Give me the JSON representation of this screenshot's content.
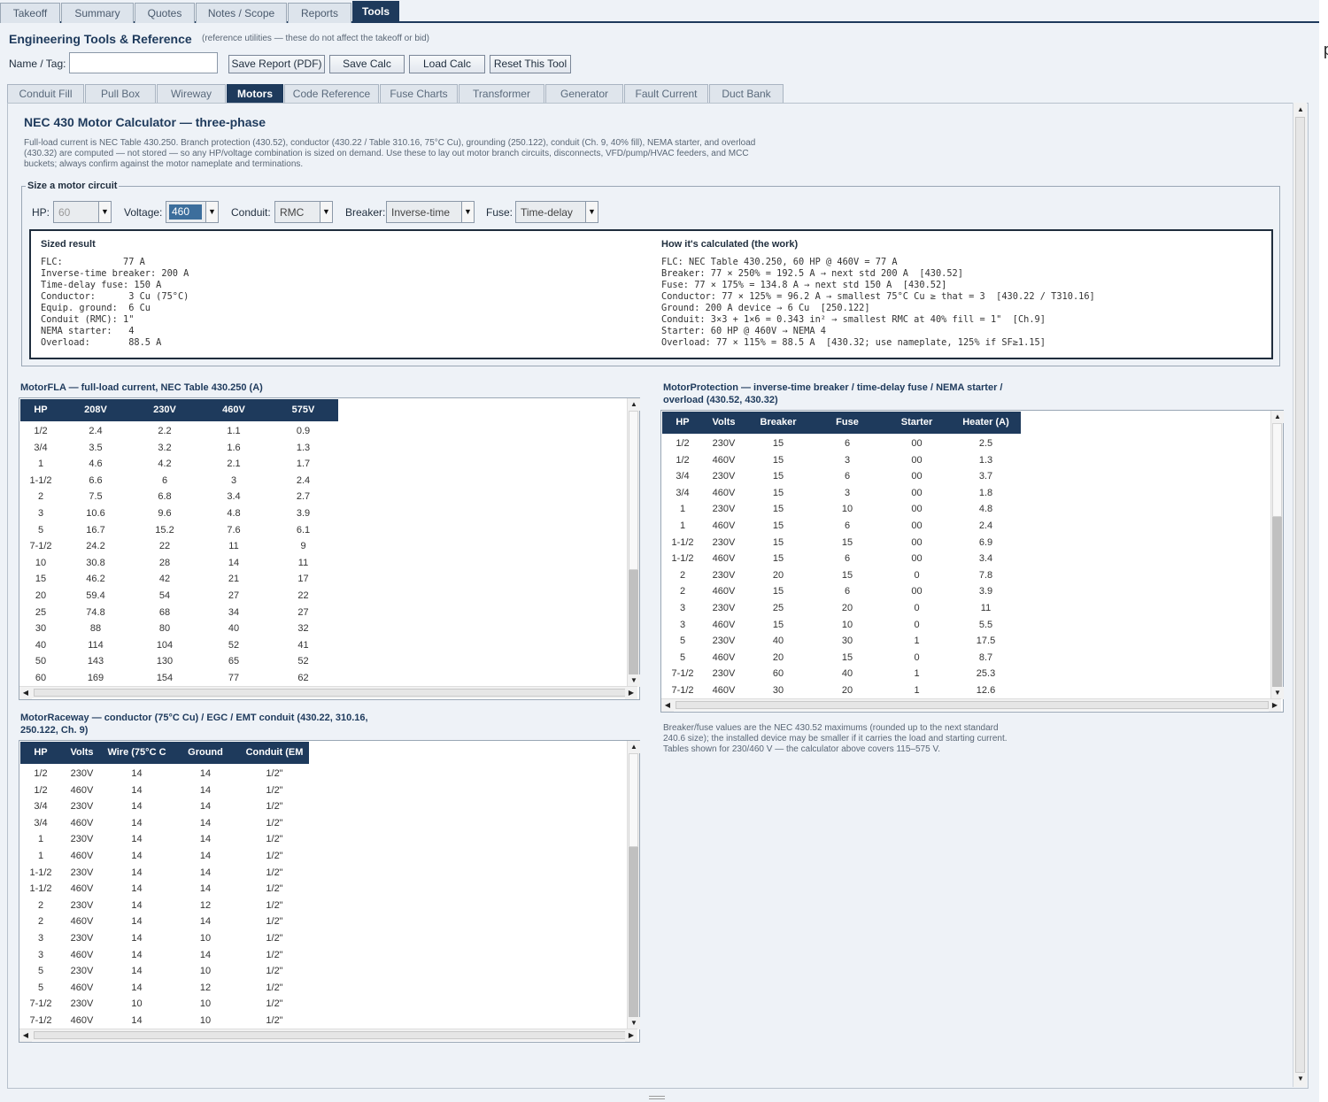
{
  "top_tabs": [
    {
      "label": "Takeoff"
    },
    {
      "label": "Summary"
    },
    {
      "label": "Quotes"
    },
    {
      "label": "Notes / Scope"
    },
    {
      "label": "Reports"
    },
    {
      "label": "Tools",
      "active": true
    }
  ],
  "header": {
    "title": "Engineering Tools & Reference",
    "subtitle": "(reference utilities — these do not affect the takeoff or bid)",
    "name_label": "Name / Tag:",
    "name_value": "",
    "buttons": {
      "save_report": "Save Report (PDF)",
      "save_calc": "Save Calc",
      "load_calc": "Load Calc",
      "reset": "Reset This Tool"
    }
  },
  "tool_tabs": [
    {
      "label": "Conduit Fill"
    },
    {
      "label": "Pull Box"
    },
    {
      "label": "Wireway"
    },
    {
      "label": "Motors",
      "active": true
    },
    {
      "label": "Code Reference"
    },
    {
      "label": "Fuse Charts"
    },
    {
      "label": "Transformer"
    },
    {
      "label": "Generator"
    },
    {
      "label": "Fault Current"
    },
    {
      "label": "Duct Bank"
    }
  ],
  "calculator": {
    "title": "NEC 430 Motor Calculator — three-phase",
    "description": "Full-load current is NEC Table 430.250. Branch protection (430.52), conductor (430.22 / Table 310.16, 75°C Cu), grounding (250.122), conduit (Ch. 9, 40% fill), NEMA starter, and overload (430.32) are computed — not stored — so any HP/voltage combination is sized on demand. Use these to lay out motor branch circuits, disconnects, VFD/pump/HVAC feeders, and MCC buckets; always confirm against the motor nameplate and terminations.",
    "group_label": "Size a motor circuit",
    "hp_label": "HP:",
    "hp_value": "60",
    "voltage_label": "Voltage:",
    "voltage_value": "460",
    "conduit_label": "Conduit:",
    "conduit_value": "RMC",
    "breaker_label": "Breaker:",
    "breaker_value": "Inverse-time",
    "fuse_label": "Fuse:",
    "fuse_value": "Time-delay",
    "result_heading": "Sized result",
    "result_text": "FLC:           77 A\nInverse-time breaker: 200 A\nTime-delay fuse: 150 A\nConductor:      3 Cu (75°C)\nEquip. ground:  6 Cu\nConduit (RMC): 1\"\nNEMA starter:   4\nOverload:       88.5 A",
    "work_heading": "How it's calculated (the work)",
    "work_text": "FLC: NEC Table 430.250, 60 HP @ 460V = 77 A\nBreaker: 77 × 250% = 192.5 A → next std 200 A  [430.52]\nFuse: 77 × 175% = 134.8 A → next std 150 A  [430.52]\nConductor: 77 × 125% = 96.2 A → smallest 75°C Cu ≥ that = 3  [430.22 / T310.16]\nGround: 200 A device → 6 Cu  [250.122]\nConduit: 3×3 + 1×6 = 0.343 in² → smallest RMC at 40% fill = 1\"  [Ch.9]\nStarter: 60 HP @ 460V → NEMA 4\nOverload: 77 × 115% = 88.5 A  [430.32; use nameplate, 125% if SF≥1.15]"
  },
  "fla_table": {
    "title": "MotorFLA — full-load current, NEC Table 430.250 (A)",
    "columns": [
      "HP",
      "208V",
      "230V",
      "460V",
      "575V"
    ],
    "rows": [
      [
        "1/2",
        "2.4",
        "2.2",
        "1.1",
        "0.9"
      ],
      [
        "3/4",
        "3.5",
        "3.2",
        "1.6",
        "1.3"
      ],
      [
        "1",
        "4.6",
        "4.2",
        "2.1",
        "1.7"
      ],
      [
        "1-1/2",
        "6.6",
        "6",
        "3",
        "2.4"
      ],
      [
        "2",
        "7.5",
        "6.8",
        "3.4",
        "2.7"
      ],
      [
        "3",
        "10.6",
        "9.6",
        "4.8",
        "3.9"
      ],
      [
        "5",
        "16.7",
        "15.2",
        "7.6",
        "6.1"
      ],
      [
        "7-1/2",
        "24.2",
        "22",
        "11",
        "9"
      ],
      [
        "10",
        "30.8",
        "28",
        "14",
        "11"
      ],
      [
        "15",
        "46.2",
        "42",
        "21",
        "17"
      ],
      [
        "20",
        "59.4",
        "54",
        "27",
        "22"
      ],
      [
        "25",
        "74.8",
        "68",
        "34",
        "27"
      ],
      [
        "30",
        "88",
        "80",
        "40",
        "32"
      ],
      [
        "40",
        "114",
        "104",
        "52",
        "41"
      ],
      [
        "50",
        "143",
        "130",
        "65",
        "52"
      ],
      [
        "60",
        "169",
        "154",
        "77",
        "62"
      ]
    ]
  },
  "protection_table": {
    "title": "MotorProtection — inverse-time breaker / time-delay fuse / NEMA starter / overload (430.52, 430.32)",
    "columns": [
      "HP",
      "Volts",
      "Breaker",
      "Fuse",
      "Starter",
      "Heater (A)"
    ],
    "rows": [
      [
        "1/2",
        "230V",
        "15",
        "6",
        "00",
        "2.5"
      ],
      [
        "1/2",
        "460V",
        "15",
        "3",
        "00",
        "1.3"
      ],
      [
        "3/4",
        "230V",
        "15",
        "6",
        "00",
        "3.7"
      ],
      [
        "3/4",
        "460V",
        "15",
        "3",
        "00",
        "1.8"
      ],
      [
        "1",
        "230V",
        "15",
        "10",
        "00",
        "4.8"
      ],
      [
        "1",
        "460V",
        "15",
        "6",
        "00",
        "2.4"
      ],
      [
        "1-1/2",
        "230V",
        "15",
        "15",
        "00",
        "6.9"
      ],
      [
        "1-1/2",
        "460V",
        "15",
        "6",
        "00",
        "3.4"
      ],
      [
        "2",
        "230V",
        "20",
        "15",
        "0",
        "7.8"
      ],
      [
        "2",
        "460V",
        "15",
        "6",
        "00",
        "3.9"
      ],
      [
        "3",
        "230V",
        "25",
        "20",
        "0",
        "11"
      ],
      [
        "3",
        "460V",
        "15",
        "10",
        "0",
        "5.5"
      ],
      [
        "5",
        "230V",
        "40",
        "30",
        "1",
        "17.5"
      ],
      [
        "5",
        "460V",
        "20",
        "15",
        "0",
        "8.7"
      ],
      [
        "7-1/2",
        "230V",
        "60",
        "40",
        "1",
        "25.3"
      ],
      [
        "7-1/2",
        "460V",
        "30",
        "20",
        "1",
        "12.6"
      ]
    ]
  },
  "raceway_table": {
    "title": "MotorRaceway — conductor (75°C Cu) / EGC / EMT conduit (430.22, 310.16, 250.122, Ch. 9)",
    "columns": [
      "HP",
      "Volts",
      "Wire (75°C C",
      "Ground",
      "Conduit (EM"
    ],
    "rows": [
      [
        "1/2",
        "230V",
        "14",
        "14",
        "1/2\""
      ],
      [
        "1/2",
        "460V",
        "14",
        "14",
        "1/2\""
      ],
      [
        "3/4",
        "230V",
        "14",
        "14",
        "1/2\""
      ],
      [
        "3/4",
        "460V",
        "14",
        "14",
        "1/2\""
      ],
      [
        "1",
        "230V",
        "14",
        "14",
        "1/2\""
      ],
      [
        "1",
        "460V",
        "14",
        "14",
        "1/2\""
      ],
      [
        "1-1/2",
        "230V",
        "14",
        "14",
        "1/2\""
      ],
      [
        "1-1/2",
        "460V",
        "14",
        "14",
        "1/2\""
      ],
      [
        "2",
        "230V",
        "14",
        "12",
        "1/2\""
      ],
      [
        "2",
        "460V",
        "14",
        "14",
        "1/2\""
      ],
      [
        "3",
        "230V",
        "14",
        "10",
        "1/2\""
      ],
      [
        "3",
        "460V",
        "14",
        "14",
        "1/2\""
      ],
      [
        "5",
        "230V",
        "14",
        "10",
        "1/2\""
      ],
      [
        "5",
        "460V",
        "14",
        "12",
        "1/2\""
      ],
      [
        "7-1/2",
        "230V",
        "10",
        "10",
        "1/2\""
      ],
      [
        "7-1/2",
        "460V",
        "14",
        "10",
        "1/2\""
      ]
    ]
  },
  "note": "Breaker/fuse values are the NEC 430.52 maximums (rounded up to the next standard 240.6 size); the installed device may be smaller if it carries the load and starting current. Tables shown for 230/460 V — the calculator above covers 115–575 V.",
  "stray_glyph": "p",
  "colors": {
    "accent": "#1e3a5c",
    "background": "#eef2f7",
    "selected": "#3c6e9c"
  }
}
